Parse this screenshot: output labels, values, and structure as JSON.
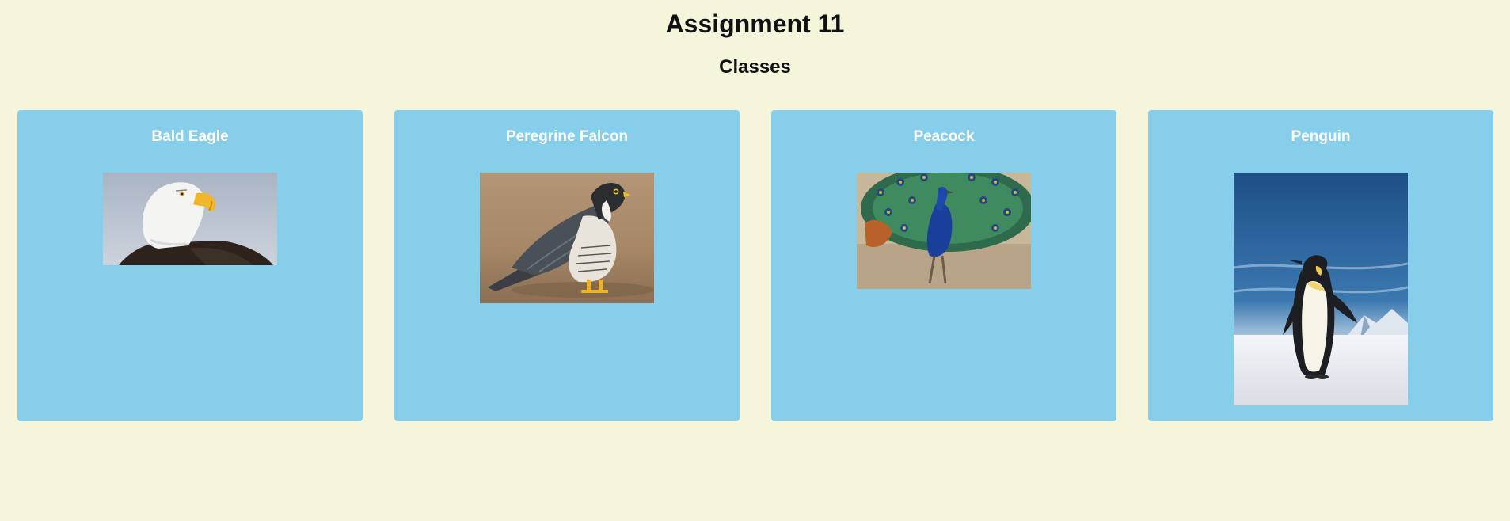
{
  "header": {
    "title": "Assignment 11",
    "subtitle": "Classes"
  },
  "cards": [
    {
      "name": "Bald Eagle",
      "image": "bald-eagle-photo"
    },
    {
      "name": "Peregrine Falcon",
      "image": "peregrine-falcon-photo"
    },
    {
      "name": "Peacock",
      "image": "peacock-photo"
    },
    {
      "name": "Penguin",
      "image": "penguin-photo"
    }
  ],
  "colors": {
    "page_background": "#f5f5dc",
    "card_background": "#87ceeb",
    "card_title": "#ffffff"
  }
}
